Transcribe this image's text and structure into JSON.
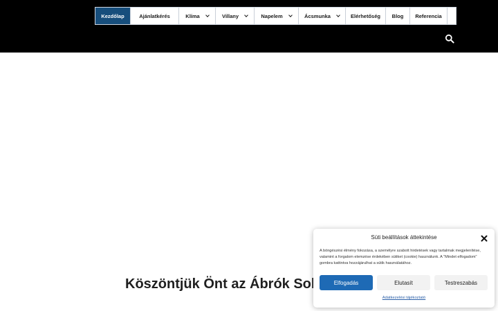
{
  "nav": {
    "items": [
      {
        "label": "Kezdőlap",
        "active": true,
        "dropdown": false
      },
      {
        "label": "Ajánlatkérés",
        "active": false,
        "dropdown": false
      },
      {
        "label": "Klíma",
        "active": false,
        "dropdown": true
      },
      {
        "label": "Villany",
        "active": false,
        "dropdown": true
      },
      {
        "label": "Napelem",
        "active": false,
        "dropdown": true
      },
      {
        "label": "Ácsmunka",
        "active": false,
        "dropdown": true
      },
      {
        "label": "Elérhetőség",
        "active": false,
        "dropdown": false
      },
      {
        "label": "Blog",
        "active": false,
        "dropdown": false
      },
      {
        "label": "Referencia",
        "active": false,
        "dropdown": false
      }
    ],
    "search_icon": "search-icon"
  },
  "main": {
    "title": "Köszöntjük Önt az Ábrók Solar"
  },
  "cookie": {
    "title": "Süti beállítások áttekintése",
    "text": "A böngészési élmény fokozása, a személyre szabott hirdetések vagy tartalmak megjelenítése, valamint a forgalom elemzése érdekében sütiket (cookie) használunk. A \"Mindet elfogadom\" gombra kattintva hozzájárulhat a sütik használatához.",
    "accept_label": "Elfogadás",
    "deny_label": "Elutasít",
    "prefs_label": "Testreszabás",
    "policy_link": "Adatkezelési tájékoztató"
  },
  "colors": {
    "header_bg": "#000000",
    "nav_active_bg": "#174e7c",
    "accept_button": "#1e6ab5"
  }
}
